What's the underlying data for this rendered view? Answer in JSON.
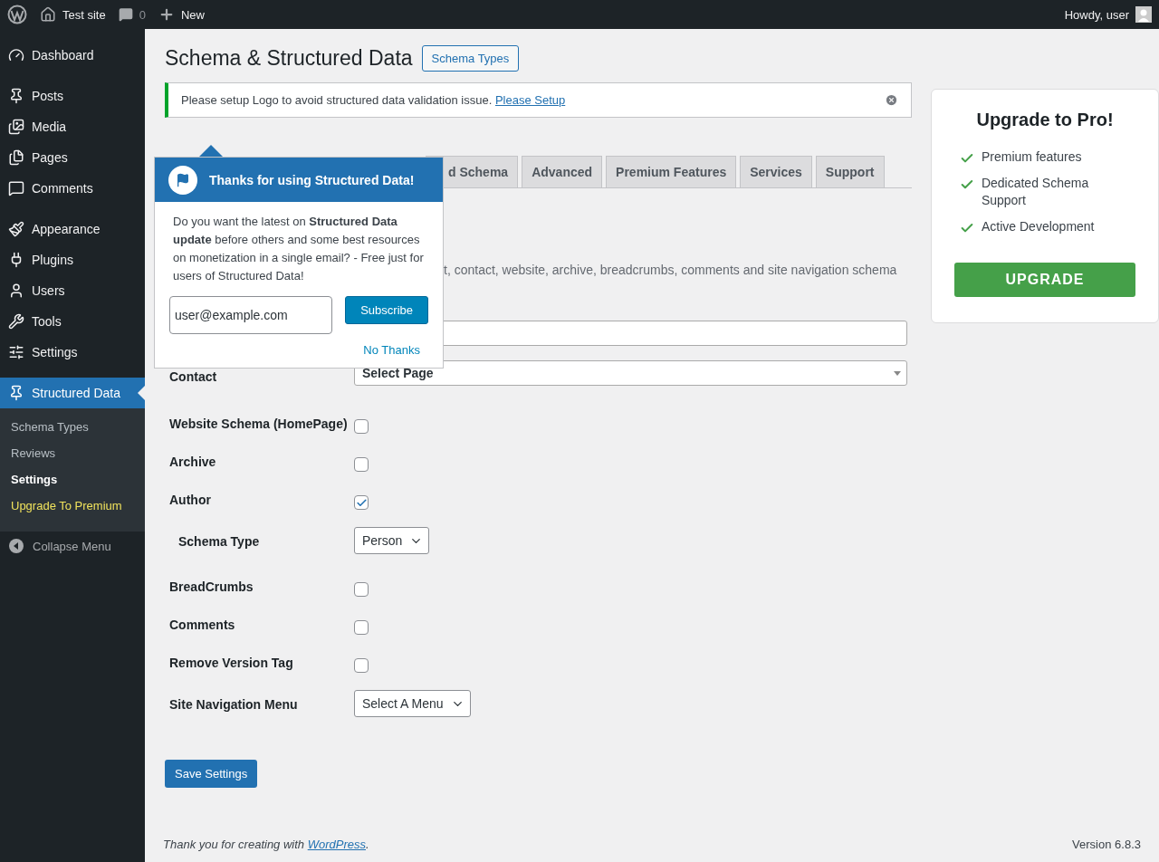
{
  "admin_bar": {
    "site": "Test site",
    "comments": "0",
    "new": "New",
    "greeting": "Howdy, user"
  },
  "sidebar": {
    "groups": [
      [
        {
          "label": "Dashboard",
          "selected": false
        }
      ],
      [
        {
          "label": "Posts",
          "selected": false
        },
        {
          "label": "Media",
          "selected": false
        },
        {
          "label": "Pages",
          "selected": false
        },
        {
          "label": "Comments",
          "selected": false
        }
      ],
      [
        {
          "label": "Appearance",
          "selected": false
        },
        {
          "label": "Plugins",
          "selected": false
        },
        {
          "label": "Users",
          "selected": false
        },
        {
          "label": "Tools",
          "selected": false
        },
        {
          "label": "Settings",
          "selected": false
        }
      ],
      [
        {
          "label": "Structured Data",
          "selected": true,
          "children": [
            {
              "label": "Schema Types",
              "selected": false,
              "kind": "link"
            },
            {
              "label": "Reviews",
              "selected": false,
              "kind": "link"
            },
            {
              "label": "Settings",
              "selected": true,
              "kind": "link"
            },
            {
              "label": "Upgrade To Premium",
              "selected": false,
              "kind": "promo"
            }
          ]
        }
      ]
    ],
    "collapse": "Collapse Menu"
  },
  "page": {
    "title": "Schema & Structured Data",
    "title_button": "Schema Types",
    "notice": {
      "text": "Please setup Logo to avoid structured data validation issue.",
      "link": " Please Setup"
    },
    "tabs": [
      {
        "label": "d Schema",
        "selected": false
      },
      {
        "label": "Advanced",
        "selected": false
      },
      {
        "label": "Premium Features",
        "selected": false
      },
      {
        "label": "Services",
        "selected": false
      },
      {
        "label": "Support",
        "selected": false
      }
    ],
    "description": "t, contact, website, archive, breadcrumbs, comments and site navigation schema",
    "fields": [
      {
        "kind": "wide-select"
      },
      {
        "kind": "wide-select",
        "label": "Contact",
        "value": "Select Page"
      },
      {
        "kind": "checkbox",
        "label": "Website Schema (HomePage)",
        "checked": false
      },
      {
        "kind": "checkbox",
        "label": "Archive",
        "checked": false
      },
      {
        "kind": "checkbox",
        "label": "Author",
        "checked": true,
        "children": [
          {
            "kind": "select",
            "label": "Schema Type",
            "value": "Person"
          }
        ]
      },
      {
        "kind": "checkbox",
        "label": "BreadCrumbs",
        "checked": false
      },
      {
        "kind": "checkbox",
        "label": "Comments",
        "checked": false
      },
      {
        "kind": "checkbox",
        "label": "Remove Version Tag",
        "checked": false
      },
      {
        "kind": "select",
        "label": "Site Navigation Menu",
        "value": "Select A Menu"
      }
    ],
    "save": "Save Settings"
  },
  "popup": {
    "title": "Thanks for using Structured Data!",
    "body": "Do you want the latest on **Structured Data update** before others and some best resources on monetization in a single email? - Free just for users of Structured Data!",
    "email": "user@example.com",
    "subscribe": "Subscribe",
    "dismiss": "No Thanks"
  },
  "pro_box": {
    "title": "Upgrade to Pro!",
    "features": [
      "Premium features",
      "Dedicated Schema Support",
      "Active Development"
    ],
    "button": "UPGRADE"
  },
  "footer": {
    "text": "Thank you for creating with ",
    "link": "WordPress",
    "end": ".",
    "version": "Version 6.8.3"
  }
}
